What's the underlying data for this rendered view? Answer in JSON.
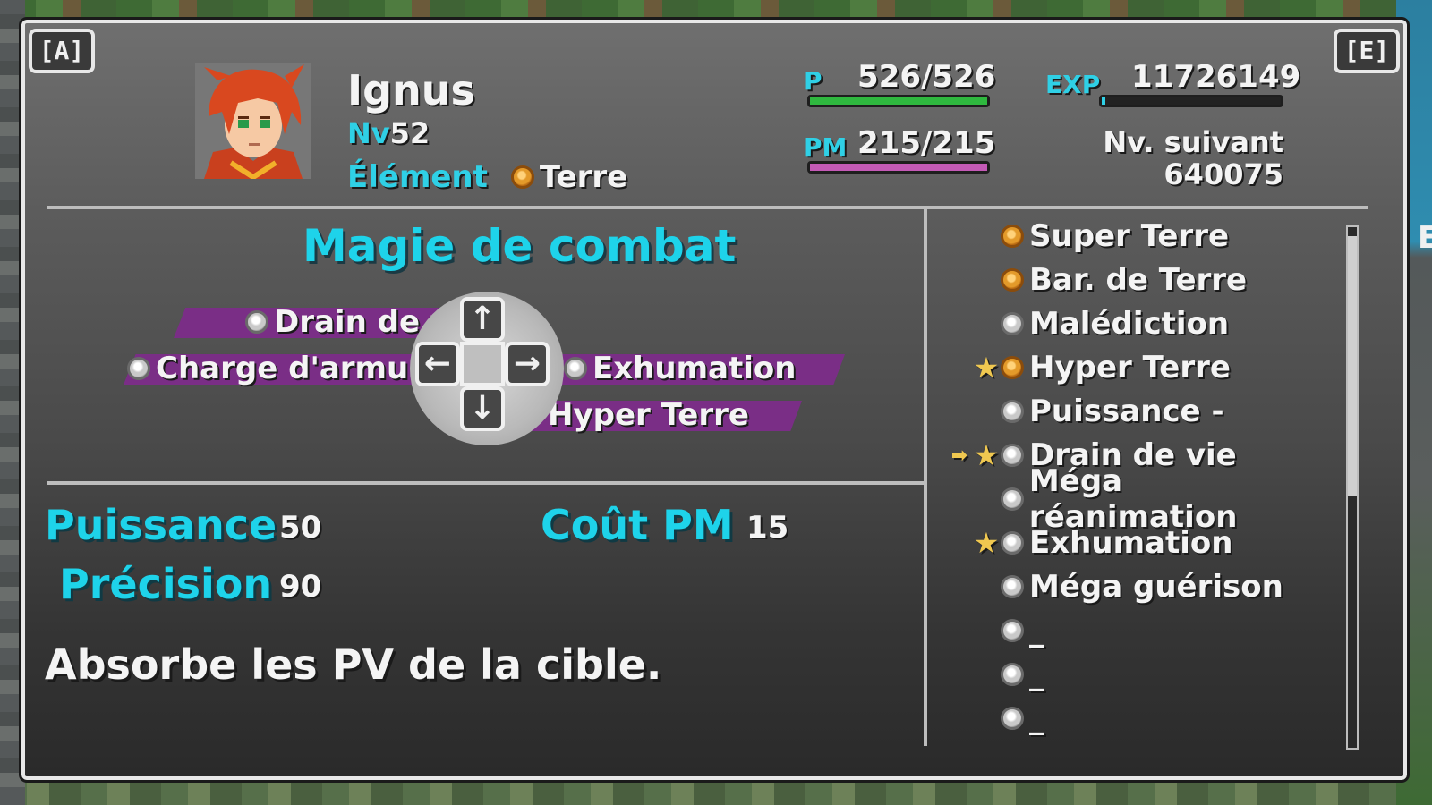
{
  "background": {
    "right_letter": "E"
  },
  "header": {
    "corner_left": "[A]",
    "corner_right": "[E]",
    "name": "Ignus",
    "level_label": "Nv",
    "level_value": "52",
    "element_label": "Élément",
    "element_value": "Terre",
    "element_icon": "earth-orb-icon",
    "hp_label": "P",
    "hp_value": "526/526",
    "hp_fraction": 1.0,
    "pm_label": "PM",
    "pm_value": "215/215",
    "pm_fraction": 1.0,
    "exp_label": "EXP",
    "exp_value": "11726149",
    "next_label": "Nv. suivant",
    "next_value": "640075",
    "colors": {
      "hp": "#2fb83f",
      "pm": "#c45ab6",
      "accent": "#1ed3ea"
    }
  },
  "magic": {
    "title": "Magie de combat",
    "up": {
      "label": "Drain de vie",
      "icon": "neutral-orb-icon",
      "arrow": "↑"
    },
    "left": {
      "label": "Charge d'armure",
      "icon": "neutral-orb-icon",
      "arrow": "←"
    },
    "right": {
      "label": "Exhumation",
      "icon": "neutral-orb-icon",
      "arrow": "→"
    },
    "down": {
      "label": "Hyper Terre",
      "icon": "earth-orb-icon",
      "arrow": "↓"
    }
  },
  "details": {
    "power_label": "Puissance",
    "power_value": "50",
    "cost_label": "Coût PM",
    "cost_value": "15",
    "accuracy_label": "Précision",
    "accuracy_value": "90",
    "description": "Absorbe les PV de la cible."
  },
  "skills": [
    {
      "label": "Super Terre",
      "icon": "earth",
      "star": "",
      "cursor": ""
    },
    {
      "label": "Bar. de Terre",
      "icon": "earth",
      "star": "",
      "cursor": ""
    },
    {
      "label": "Malédiction",
      "icon": "neutral",
      "star": "",
      "cursor": ""
    },
    {
      "label": "Hyper Terre",
      "icon": "earth",
      "star": "★",
      "cursor": ""
    },
    {
      "label": "Puissance -",
      "icon": "neutral",
      "star": "",
      "cursor": ""
    },
    {
      "label": "Drain de vie",
      "icon": "neutral",
      "star": "★",
      "cursor": "➡"
    },
    {
      "label": "Méga réanimation",
      "icon": "neutral",
      "star": "",
      "cursor": ""
    },
    {
      "label": "Exhumation",
      "icon": "neutral",
      "star": "★",
      "cursor": ""
    },
    {
      "label": "Méga guérison",
      "icon": "neutral",
      "star": "",
      "cursor": ""
    },
    {
      "label": "_",
      "icon": "neutral",
      "star": "",
      "cursor": ""
    },
    {
      "label": "_",
      "icon": "neutral",
      "star": "",
      "cursor": ""
    },
    {
      "label": "_",
      "icon": "neutral",
      "star": "",
      "cursor": ""
    }
  ]
}
